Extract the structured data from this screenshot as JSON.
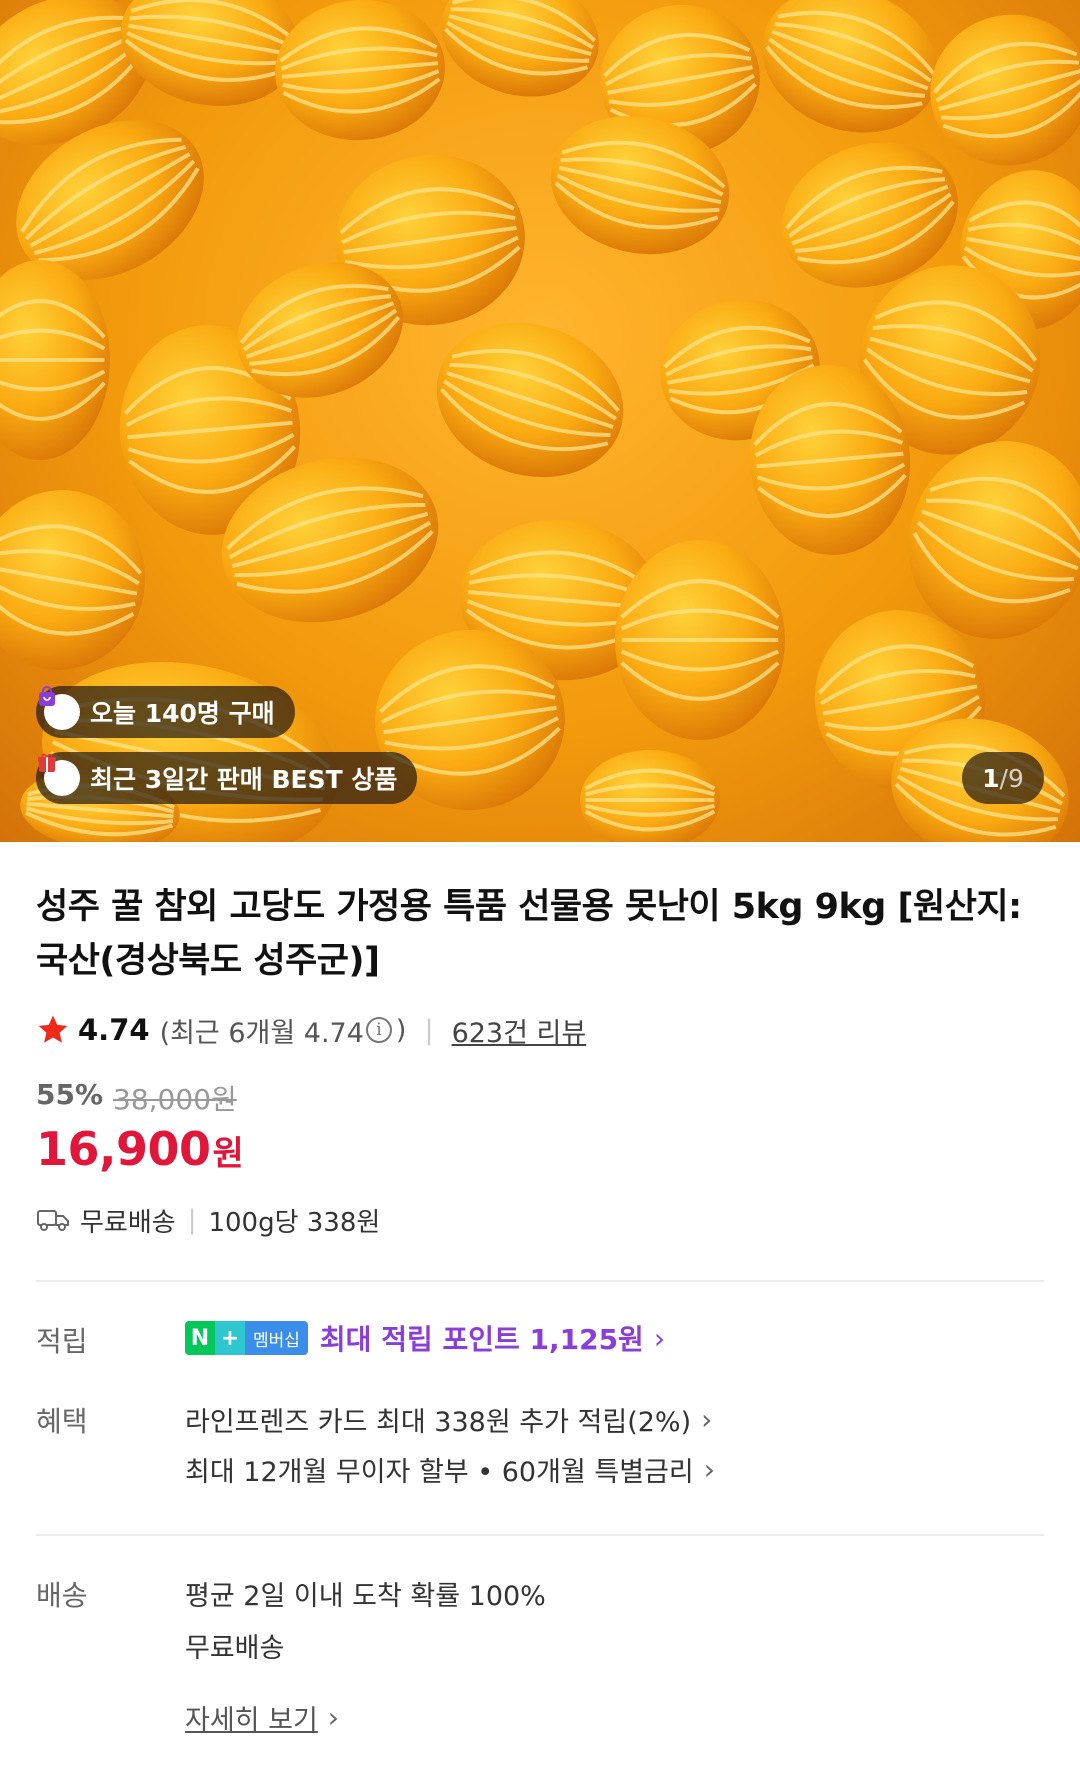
{
  "hero": {
    "badges": [
      {
        "icon": "shopping-bag-icon",
        "text": "오늘 140명 구매",
        "icon_color": "#8b3dd9"
      },
      {
        "icon": "gift-icon",
        "text": "최근 3일간 판매 BEST 상품",
        "icon_color": "#e23a3a"
      }
    ],
    "counter": {
      "current": "1",
      "separator": "/",
      "total": "9"
    }
  },
  "product": {
    "title": "성주 꿀 참외 고당도 가정용 특품 선물용 못난이 5kg 9kg [원산지: 국산(경상북도 성주군)]",
    "rating": {
      "score": "4.74",
      "recent_prefix": "(최근 6개월 4.74",
      "recent_suffix": ")",
      "reviews": "623건 리뷰"
    },
    "discount": {
      "percent": "55%",
      "original": "38,000원"
    },
    "price": {
      "amount": "16,900",
      "unit": "원"
    },
    "shipping": {
      "free": "무료배송",
      "per_unit": "100g당 338원"
    }
  },
  "points": {
    "label": "적립",
    "badge": {
      "n": "N",
      "plus": "+",
      "member": "멤버십"
    },
    "text": "최대 적립 포인트 1,125원"
  },
  "benefits": {
    "label": "혜택",
    "lines": [
      "라인프렌즈 카드 최대 338원 추가 적립(2%)",
      "최대 12개월 무이자 할부 • 60개월 특별금리"
    ]
  },
  "delivery": {
    "label": "배송",
    "lines": [
      "평균 2일 이내 도착 확률 100%",
      "무료배송"
    ],
    "detail_link": "자세히 보기"
  },
  "colors": {
    "accent_price": "#e0163a",
    "points_purple": "#8b3dd9",
    "star": "#f02a1a"
  }
}
